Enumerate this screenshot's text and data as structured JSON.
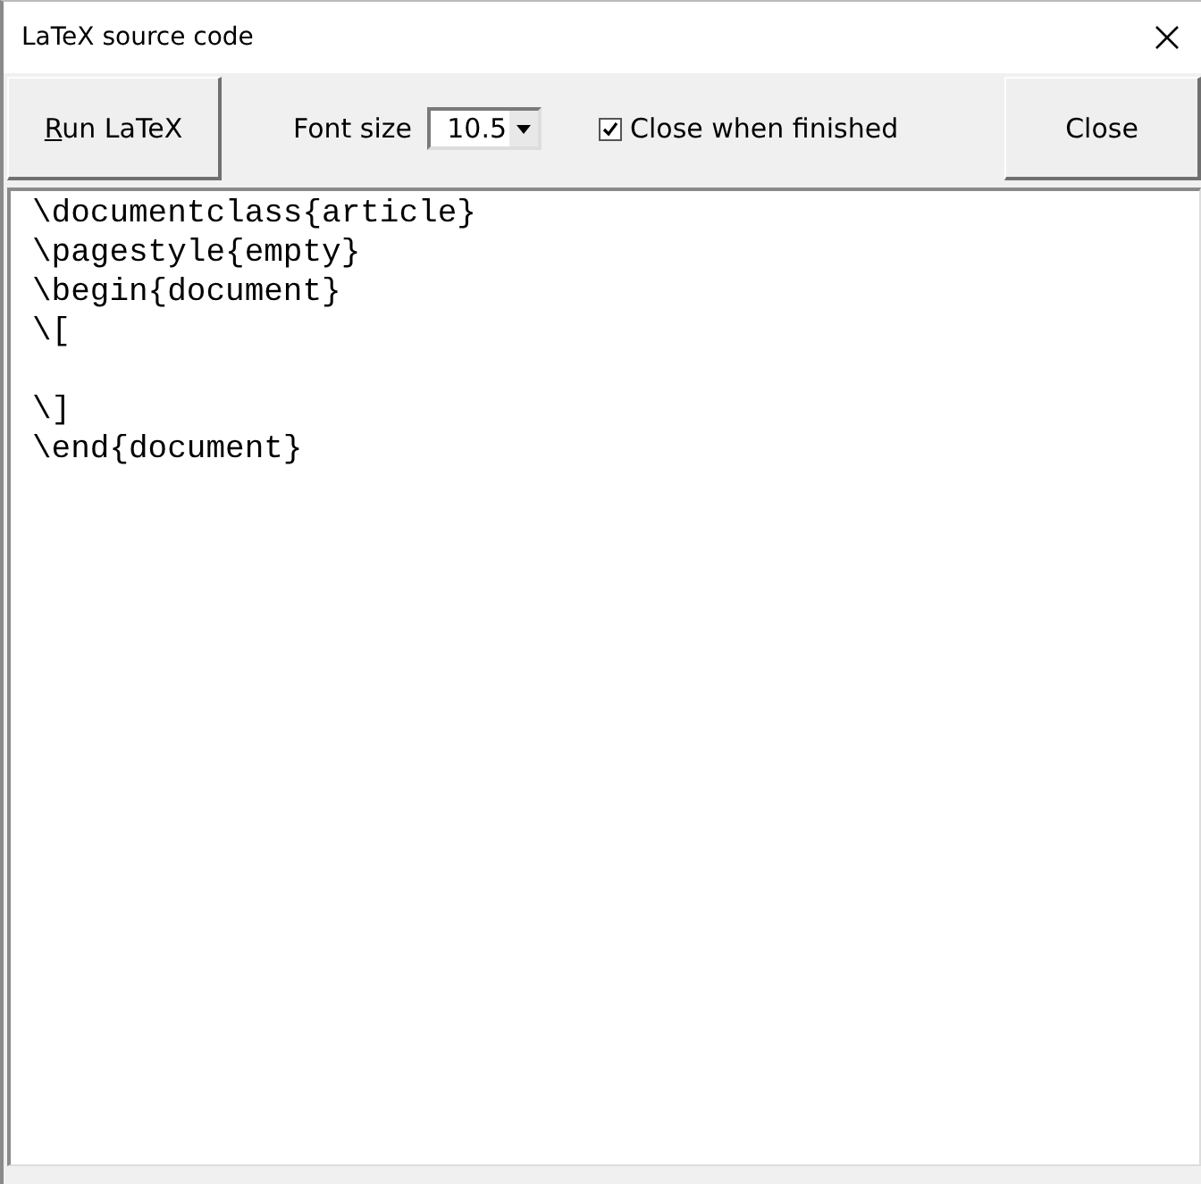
{
  "window": {
    "title": "LaTeX source code"
  },
  "toolbar": {
    "run_button": "Run LaTeX",
    "font_size_label": "Font size",
    "font_size_value": "10.5",
    "close_when_finished": {
      "label": "Close when finished",
      "checked": true
    },
    "close_button": "Close"
  },
  "editor": {
    "source": "\\documentclass{article}\n\\pagestyle{empty}\n\\begin{document}\n\\[\n\n\\]\n\\end{document}"
  }
}
